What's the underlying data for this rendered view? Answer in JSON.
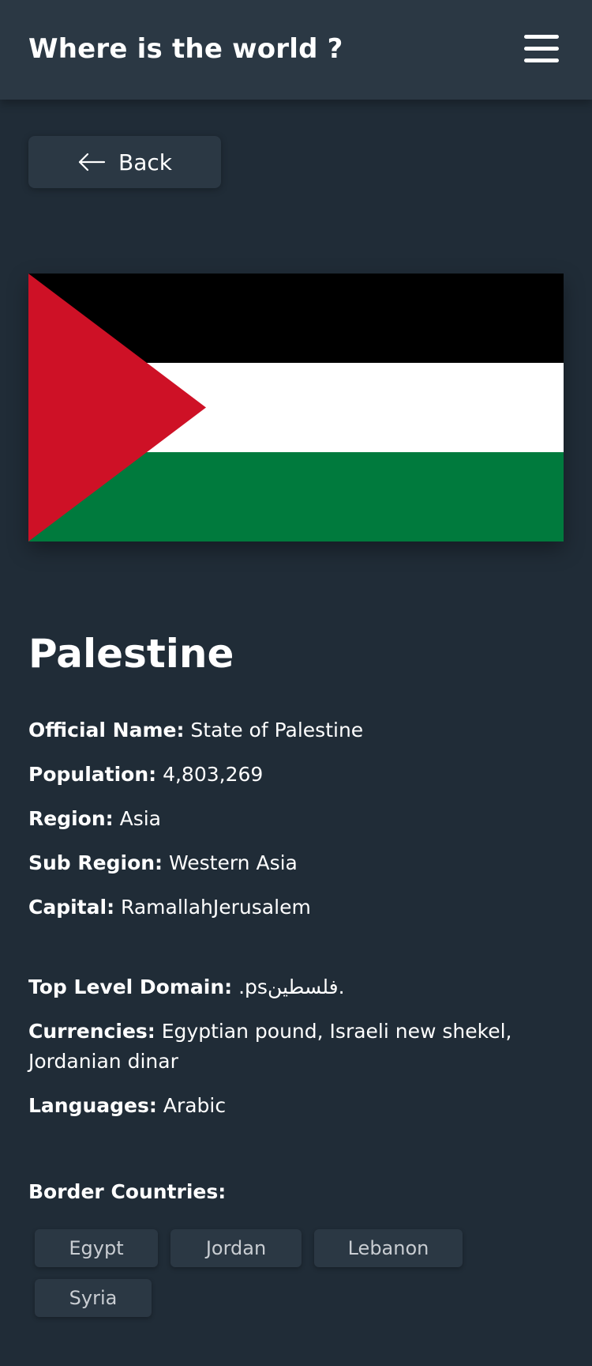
{
  "header": {
    "title": "Where is the world ?",
    "menu_icon": "hamburger-menu-icon"
  },
  "back_button": {
    "label": "Back",
    "icon": "arrow-left-icon"
  },
  "country": {
    "name": "Palestine",
    "flag_colors": [
      "#000000",
      "#ffffff",
      "#007a3d",
      "#ce1126"
    ],
    "details_primary": [
      {
        "key": "Official Name:",
        "value": "State of Palestine"
      },
      {
        "key": "Population:",
        "value": "4,803,269"
      },
      {
        "key": "Region:",
        "value": "Asia"
      },
      {
        "key": "Sub Region:",
        "value": "Western Asia"
      },
      {
        "key": "Capital:",
        "value": "RamallahJerusalem"
      }
    ],
    "details_secondary": [
      {
        "key": "Top Level Domain:",
        "value": ".psفلسطين."
      },
      {
        "key": "Currencies:",
        "value": "Egyptian pound, Israeli new shekel, Jordanian dinar"
      },
      {
        "key": "Languages:",
        "value": "Arabic"
      }
    ],
    "border_countries_label": "Border Countries:",
    "border_countries": [
      "Egypt",
      "Jordan",
      "Lebanon",
      "Syria"
    ]
  },
  "colors": {
    "background": "#202c37",
    "surface": "#2b3844",
    "text": "#ffffff"
  }
}
